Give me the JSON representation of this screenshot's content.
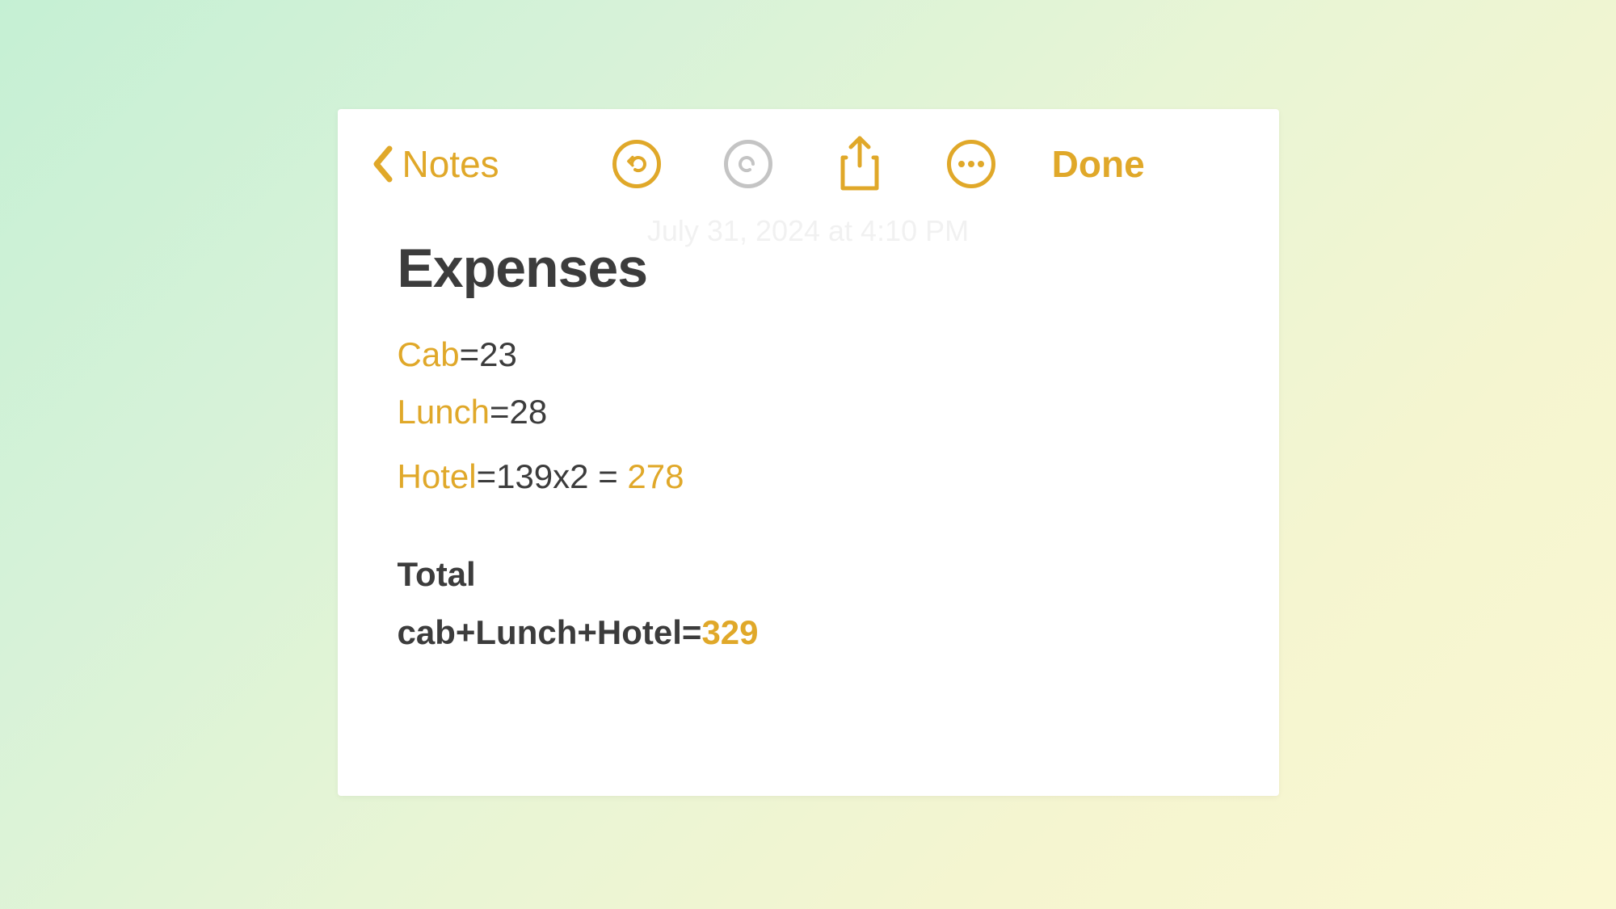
{
  "toolbar": {
    "back_label": "Notes",
    "done_label": "Done"
  },
  "timestamp": "July 31, 2024 at 4:10 PM",
  "note": {
    "title": "Expenses",
    "lines": {
      "cab_var": "Cab",
      "cab_expr": "=23",
      "lunch_var": "Lunch",
      "lunch_expr": "=28",
      "hotel_var": "Hotel",
      "hotel_expr": "=139x2 = ",
      "hotel_result": "278",
      "total_label": "Total",
      "total_expr": "cab+Lunch+Hotel=",
      "total_result": "329"
    }
  },
  "colors": {
    "accent": "#e0a829",
    "text": "#3c3c3c",
    "disabled": "#c4c4c4"
  }
}
